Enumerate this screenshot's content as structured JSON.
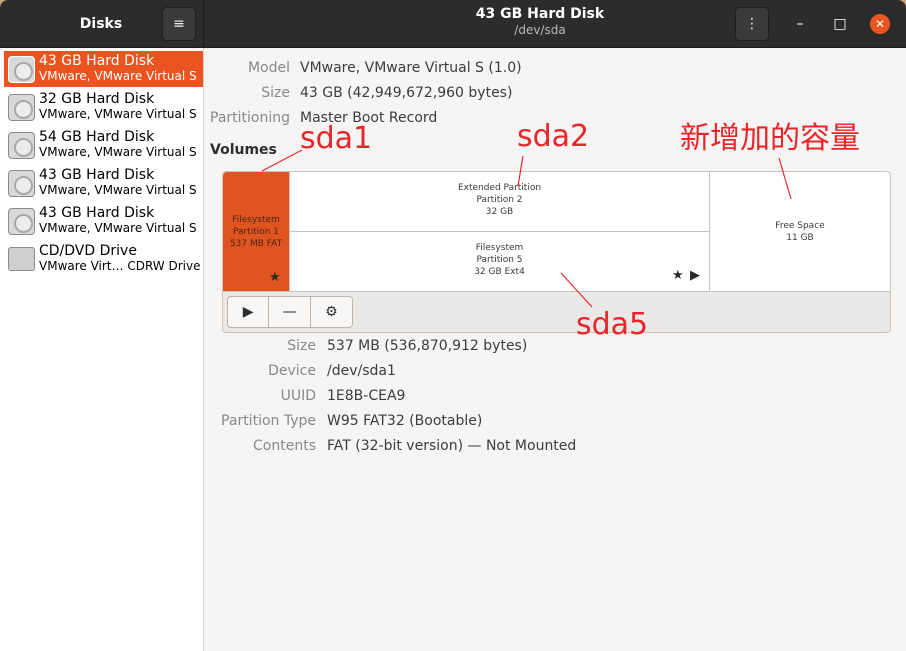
{
  "sidebar": {
    "title": "Disks",
    "disks": [
      {
        "name": "43 GB Hard Disk",
        "sub": "VMware, VMware Virtual S",
        "selected": true,
        "icon": "hard-disk-icon"
      },
      {
        "name": "32 GB Hard Disk",
        "sub": "VMware, VMware Virtual S",
        "selected": false,
        "icon": "hard-disk-icon"
      },
      {
        "name": "54 GB Hard Disk",
        "sub": "VMware, VMware Virtual S",
        "selected": false,
        "icon": "hard-disk-icon"
      },
      {
        "name": "43 GB Hard Disk",
        "sub": "VMware, VMware Virtual S",
        "selected": false,
        "icon": "hard-disk-icon"
      },
      {
        "name": "43 GB Hard Disk",
        "sub": "VMware, VMware Virtual S",
        "selected": false,
        "icon": "hard-disk-icon"
      },
      {
        "name": "CD/DVD Drive",
        "sub": "VMware Virt… CDRW Drive",
        "selected": false,
        "icon": "optical-drive-icon"
      }
    ]
  },
  "header": {
    "title": "43 GB Hard Disk",
    "subtitle": "/dev/sda",
    "hamburger_icon": "≡",
    "menu_icon": "⋮",
    "minimize_icon": "–",
    "maximize_icon": "□",
    "close_icon": "✕"
  },
  "disk_info": {
    "model_label": "Model",
    "model_value": "VMware, VMware Virtual S (1.0)",
    "size_label": "Size",
    "size_value": "43 GB (42,949,672,960 bytes)",
    "partitioning_label": "Partitioning",
    "partitioning_value": "Master Boot Record"
  },
  "volumes": {
    "label": "Volumes",
    "sda1": {
      "line1": "Filesystem",
      "line2": "Partition 1",
      "line3": "537 MB FAT"
    },
    "extended": {
      "line1": "Extended Partition",
      "line2": "Partition 2",
      "line3": "32 GB"
    },
    "p5": {
      "line1": "Filesystem",
      "line2": "Partition 5",
      "line3": "32 GB Ext4"
    },
    "free": {
      "line1": "Free Space",
      "line2": "11 GB"
    },
    "star_glyph": "★",
    "play_glyph": "▶",
    "tools": {
      "play": "▶",
      "minus": "—",
      "gear": "⚙"
    }
  },
  "partition_info": {
    "size_label": "Size",
    "size_value": "537 MB (536,870,912 bytes)",
    "device_label": "Device",
    "device_value": "/dev/sda1",
    "uuid_label": "UUID",
    "uuid_value": "1E8B-CEA9",
    "type_label": "Partition Type",
    "type_value": "W95 FAT32 (Bootable)",
    "contents_label": "Contents",
    "contents_value": "FAT (32-bit version) — Not Mounted"
  },
  "annotations": {
    "sda1": "sda1",
    "sda2": "sda2",
    "sda5": "sda5",
    "new_capacity": "新增加的容量"
  },
  "colors": {
    "accent": "#e95420",
    "annotation": "#e8262a",
    "headerbar": "#2c2c2c"
  }
}
